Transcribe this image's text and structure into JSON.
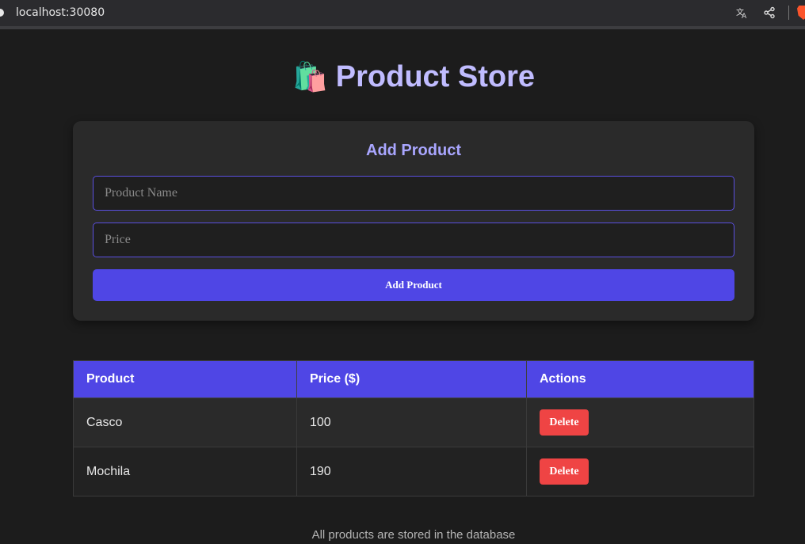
{
  "browser": {
    "url": "localhost:30080"
  },
  "header": {
    "title": "Product Store",
    "emoji": "🛍️"
  },
  "form": {
    "heading": "Add Product",
    "name_placeholder": "Product Name",
    "price_placeholder": "Price",
    "submit_label": "Add Product"
  },
  "table": {
    "columns": [
      "Product",
      "Price ($)",
      "Actions"
    ],
    "rows": [
      {
        "product": "Casco",
        "price": "100",
        "action": "Delete"
      },
      {
        "product": "Mochila",
        "price": "190",
        "action": "Delete"
      }
    ]
  },
  "footer": {
    "text": "All products are stored in the database"
  },
  "colors": {
    "accent": "#4f46e5",
    "title": "#c0bcff",
    "danger": "#ef4444",
    "background": "#1c1c1c"
  }
}
